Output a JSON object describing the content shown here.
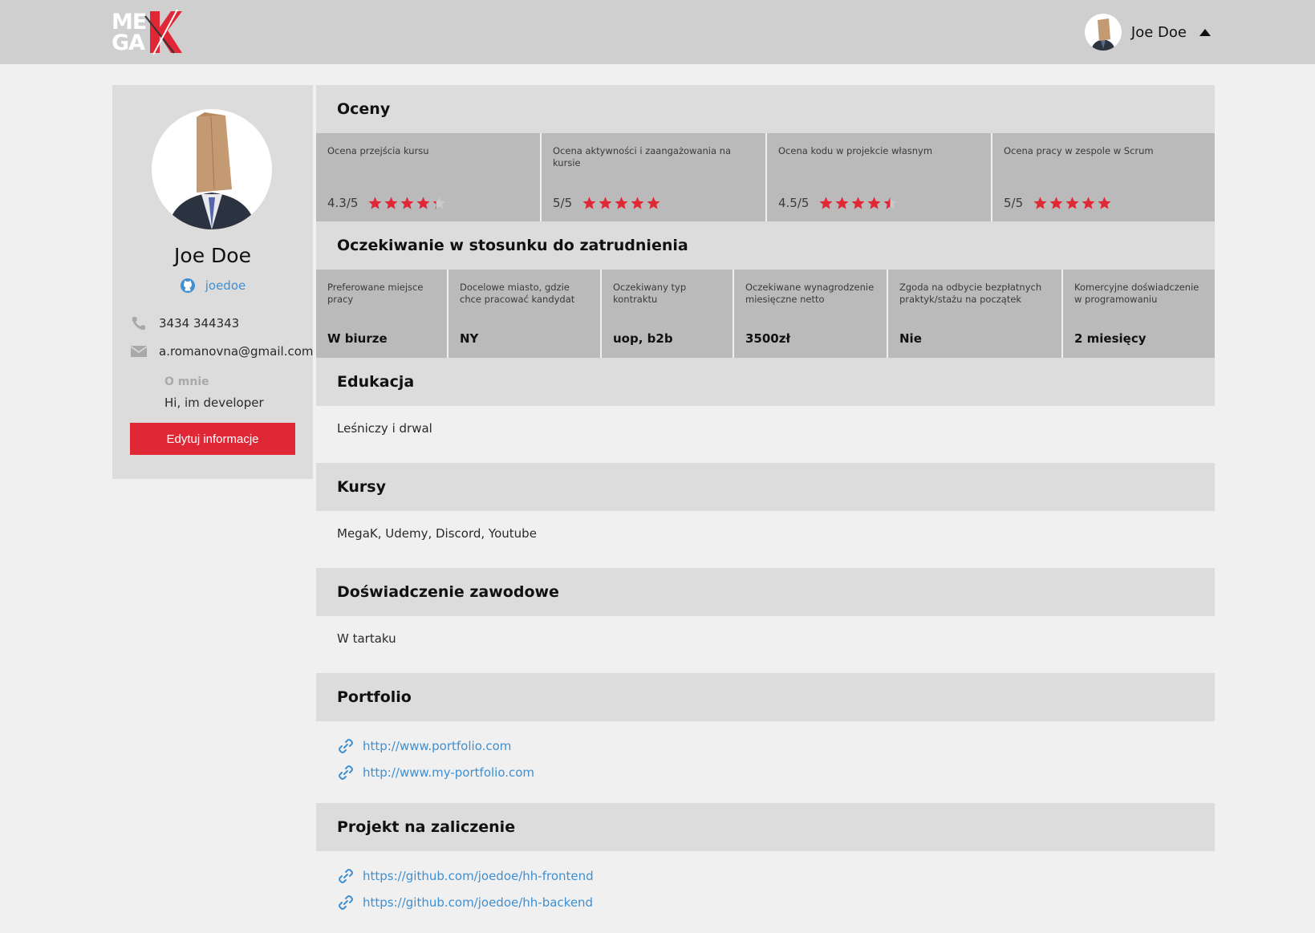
{
  "header": {
    "logo_line1": "ME",
    "logo_line2": "GA",
    "user_name": "Joe Doe",
    "brand_color": "#e02735"
  },
  "profile": {
    "name": "Joe Doe",
    "github": "joedoe",
    "phone": "3434 344343",
    "email": "a.romanovna@gmail.com",
    "about_label": "O mnie",
    "about_text": "Hi, im developer",
    "edit_label": "Edytuj informacje"
  },
  "ratings": {
    "title": "Oceny",
    "items": [
      {
        "label": "Ocena przejścia kursu",
        "score": "4.3",
        "max": "/5",
        "value": 4.3
      },
      {
        "label": "Ocena aktywności i zaangażowania na kursie",
        "score": "5",
        "max": "/5",
        "value": 5
      },
      {
        "label": "Ocena kodu w projekcie własnym",
        "score": "4.5",
        "max": "/5",
        "value": 4.5
      },
      {
        "label": "Ocena pracy w zespole w Scrum",
        "score": "5",
        "max": "/5",
        "value": 5
      }
    ]
  },
  "expectations": {
    "title": "Oczekiwanie w stosunku do zatrudnienia",
    "items": [
      {
        "label": "Preferowane miejsce pracy",
        "value": "W biurze"
      },
      {
        "label": "Docelowe miasto, gdzie chce pracować kandydat",
        "value": "NY"
      },
      {
        "label": "Oczekiwany typ kontraktu",
        "value": "uop, b2b"
      },
      {
        "label": "Oczekiwane wynagrodzenie miesięczne netto",
        "value": "3500zł"
      },
      {
        "label": "Zgoda na odbycie bezpłatnych praktyk/stażu na początek",
        "value": "Nie"
      },
      {
        "label": "Komercyjne doświadczenie w programowaniu",
        "value": "2 miesięcy"
      }
    ]
  },
  "education": {
    "title": "Edukacja",
    "text": "Leśniczy i drwal"
  },
  "courses": {
    "title": "Kursy",
    "text": "MegaK, Udemy, Discord, Youtube"
  },
  "experience": {
    "title": "Doświadczenie zawodowe",
    "text": "W tartaku"
  },
  "portfolio": {
    "title": "Portfolio",
    "links": [
      "http://www.portfolio.com",
      "http://www.my-portfolio.com"
    ]
  },
  "project": {
    "title": "Projekt na zaliczenie",
    "links": [
      "https://github.com/joedoe/hh-frontend",
      "https://github.com/joedoe/hh-backend"
    ]
  },
  "icons": {
    "github": "github-icon",
    "phone": "phone-icon",
    "mail": "mail-icon",
    "link": "link-icon",
    "star": "star-icon",
    "caret": "caret-up-icon"
  }
}
